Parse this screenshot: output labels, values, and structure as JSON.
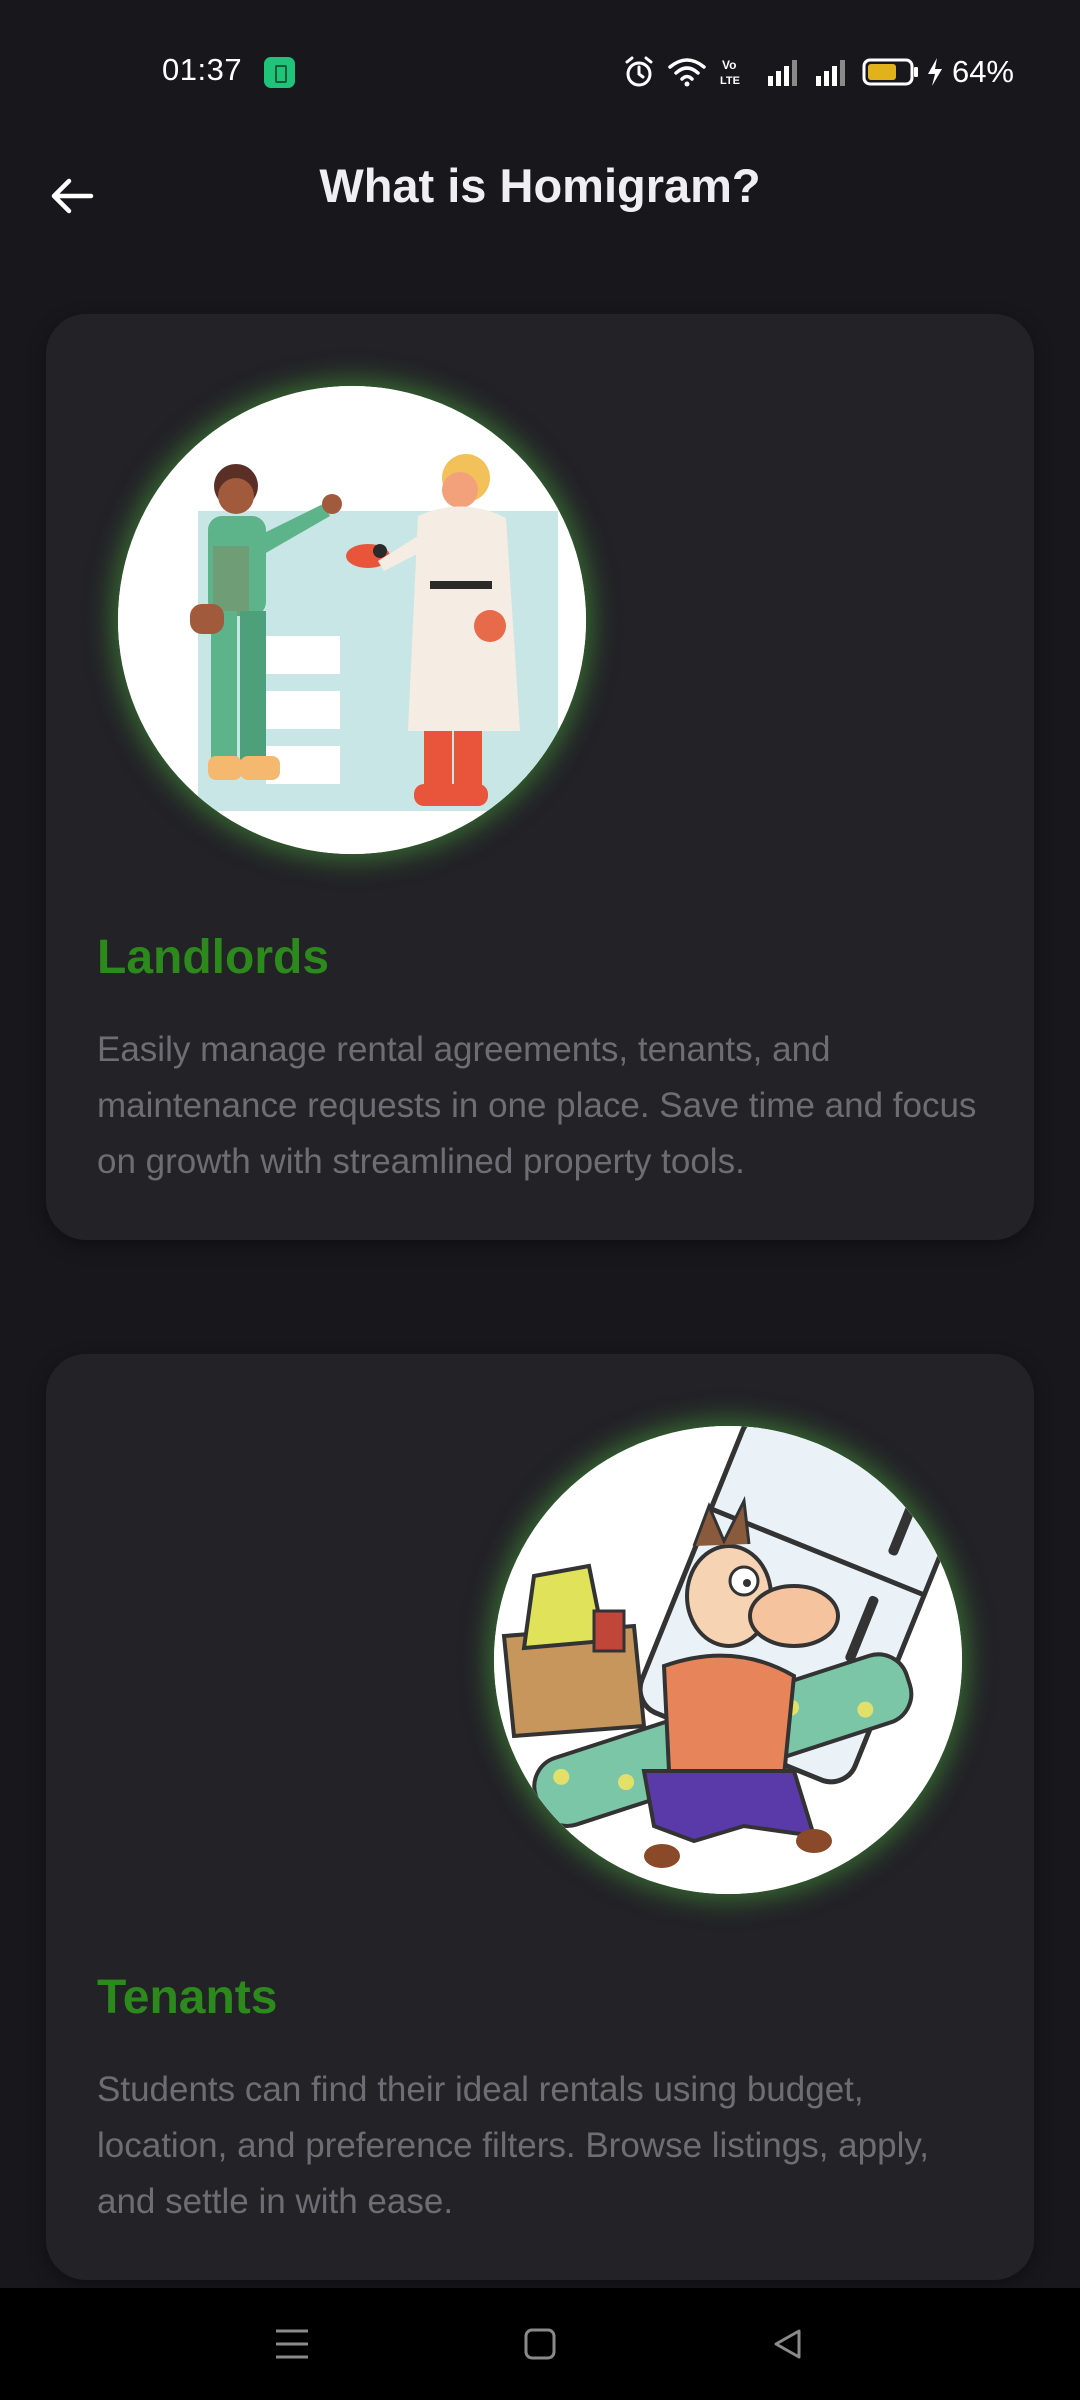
{
  "status_bar": {
    "time": "01:37",
    "battery_percent": "64%",
    "battery_level": 0.64,
    "icons": [
      "app-notification-icon",
      "alarm-icon",
      "wifi-icon",
      "volte-icon",
      "signal-icon",
      "signal-icon",
      "battery-icon",
      "charging-icon"
    ],
    "volte_label": "Vo LTE"
  },
  "header": {
    "title": "What is Homigram?",
    "back_icon": "arrow-left-icon"
  },
  "cards": [
    {
      "title": "Landlords",
      "description": "Easily manage rental agreements, tenants, and maintenance requests in one place. Save time and focus on growth with streamlined property tools.",
      "image": "landlord-handing-keys-illustration"
    },
    {
      "title": "Tenants",
      "description": "Students can find their ideal rentals using budget, location, and preference filters. Browse listings, apply, and settle in with ease.",
      "image": "man-moving-out-cartoon"
    }
  ],
  "nav_bar": {
    "icons": [
      "menu-icon",
      "home-icon",
      "back-triangle-icon"
    ]
  },
  "colors": {
    "background": "#18171c",
    "card": "#232227",
    "accent_green": "#2c8a1d",
    "glow_green": "#48aa3c",
    "text_muted": "#6e6d74",
    "title_text": "#efeef3"
  }
}
